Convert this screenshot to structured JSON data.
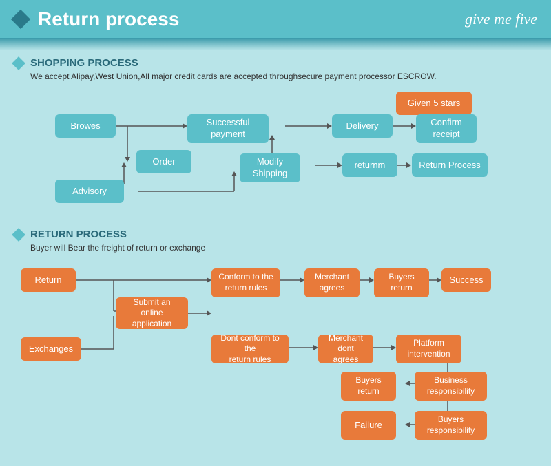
{
  "header": {
    "title": "Return process",
    "logo": "give me five"
  },
  "shopping": {
    "section_title": "SHOPPING PROCESS",
    "description": "We accept Alipay,West Union,All major credit cards are accepted throughsecure payment processor ESCROW.",
    "nodes": {
      "browes": "Browes",
      "order": "Order",
      "advisory": "Advisory",
      "modify_shipping": "Modify\nShipping",
      "successful_payment": "Successful\npayment",
      "delivery": "Delivery",
      "confirm_receipt": "Confirm\nreceipt",
      "given_5_stars": "Given 5 stars",
      "returnm": "returnm",
      "return_process": "Return Process"
    }
  },
  "return": {
    "section_title": "RETURN PROCESS",
    "description": "Buyer will Bear the freight of return or exchange",
    "nodes": {
      "return": "Return",
      "exchanges": "Exchanges",
      "submit": "Submit an online\napplication",
      "conform": "Conform to the\nreturn rules",
      "dont_conform": "Dont conform to the\nreturn rules",
      "merchant_agrees": "Merchant\nagrees",
      "merchant_dont": "Merchant\ndont agrees",
      "buyers_return_1": "Buyers\nreturn",
      "buyers_return_2": "Buyers\nreturn",
      "platform": "Platform\nintervention",
      "success": "Success",
      "business_resp": "Business\nresponsibility",
      "buyers_resp": "Buyers\nresponsibility",
      "failure": "Failure"
    }
  }
}
